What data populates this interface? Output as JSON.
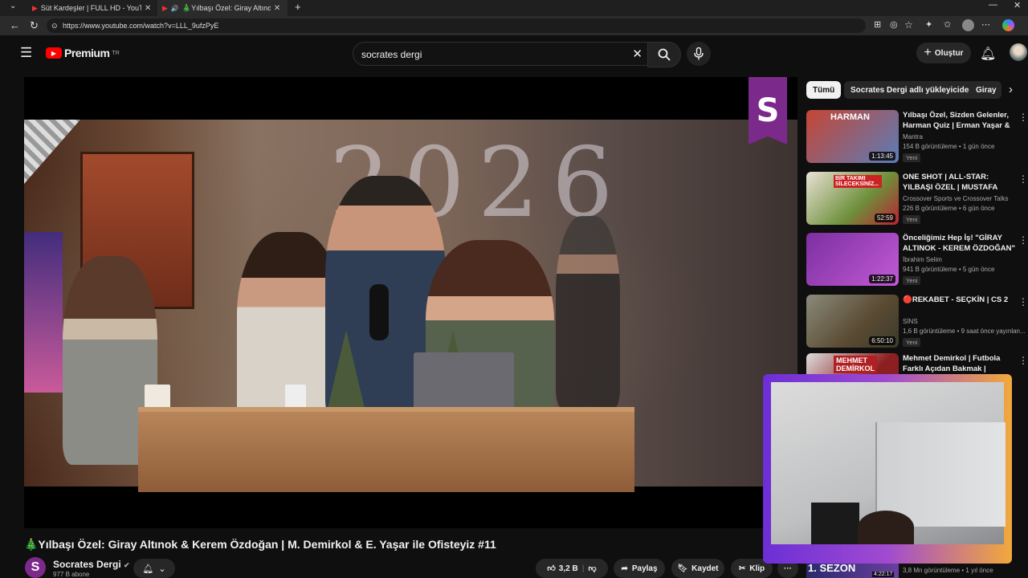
{
  "browser": {
    "tabs": [
      {
        "label": "Süt Kardeşler | FULL HD - YouTube"
      },
      {
        "label": "🎄Yılbaşı Özel: Giray Altınok"
      }
    ],
    "new_tab": "+",
    "url": "https://www.youtube.com/watch?v=LLL_9ufzPyE"
  },
  "header": {
    "logo": "Premium",
    "logo_sup": "TR",
    "search_value": "socrates dergi",
    "create_label": "Oluştur"
  },
  "video": {
    "overlay_logo": "S",
    "title": "🎄Yılbaşı Özel: Giray Altınok & Kerem Özdoğan | M. Demirkol & E. Yaşar ile Ofisteyiz #11",
    "channel": "Socrates Dergi",
    "channel_avatar": "S",
    "subscribers": "977 B abone",
    "likes": "3,2 B",
    "share": "Paylaş",
    "save": "Kaydet",
    "clip": "Klip",
    "more": "···"
  },
  "filters": {
    "chips": [
      "Tümü",
      "Socrates Dergi adlı yükleyiciden",
      "Giray"
    ]
  },
  "recommendations": [
    {
      "title": "Yılbaşı Özel, Sizden Gelenler, Harman Quiz | Erman Yaşar & ...",
      "channel": "Mantra",
      "meta": "154 B görüntüleme • 1 gün önce",
      "badge": "Yeni",
      "duration": "1:13:45",
      "thumb_text": "HARMAN",
      "color": "#b53a2c"
    },
    {
      "title": "ONE SHOT | ALL-STAR: YILBAŞI ÖZEL | MUSTAFA DEMİRTAŞ, ...",
      "channel": "Crossover Sports ve Crossover Talks",
      "meta": "226 B görüntüleme • 6 gün önce",
      "badge": "Yeni",
      "duration": "52:59",
      "thumb_text": "BİR TAKIMI SİLECEKSİNİZ...",
      "color": "#6d8f3a"
    },
    {
      "title": "Önceliğimiz Hep İş! \"GİRAY ALTINOK - KEREM ÖZDOĞAN\" ...",
      "channel": "İbrahim Selim",
      "meta": "941 B görüntüleme • 5 gün önce",
      "badge": "Yeni",
      "duration": "1:22:37",
      "thumb_text": "",
      "color": "#a13fbf"
    },
    {
      "title": "🔴REKABET - SEÇKİN | CS 2",
      "channel": "SİNS",
      "meta": "1,6 B görüntüleme • 9 saat önce yayınlan...",
      "badge": "Yeni",
      "duration": "6:50:10",
      "thumb_text": "",
      "color": "#7a6a4a"
    },
    {
      "title": "Mehmet Demirkol | Futbola Farklı Açıdan Bakmak | Kimsin...",
      "channel": "",
      "meta": "",
      "badge": "",
      "duration": "",
      "thumb_text": "MEHMET DEMİRKOL",
      "color": "#8c1f22"
    }
  ],
  "bottom": {
    "thumb_text": "1. SEZON",
    "duration": "4:22:17",
    "meta": "3,8 Mn görüntüleme • 1 yıl önce"
  },
  "video_scene_text": "2026"
}
